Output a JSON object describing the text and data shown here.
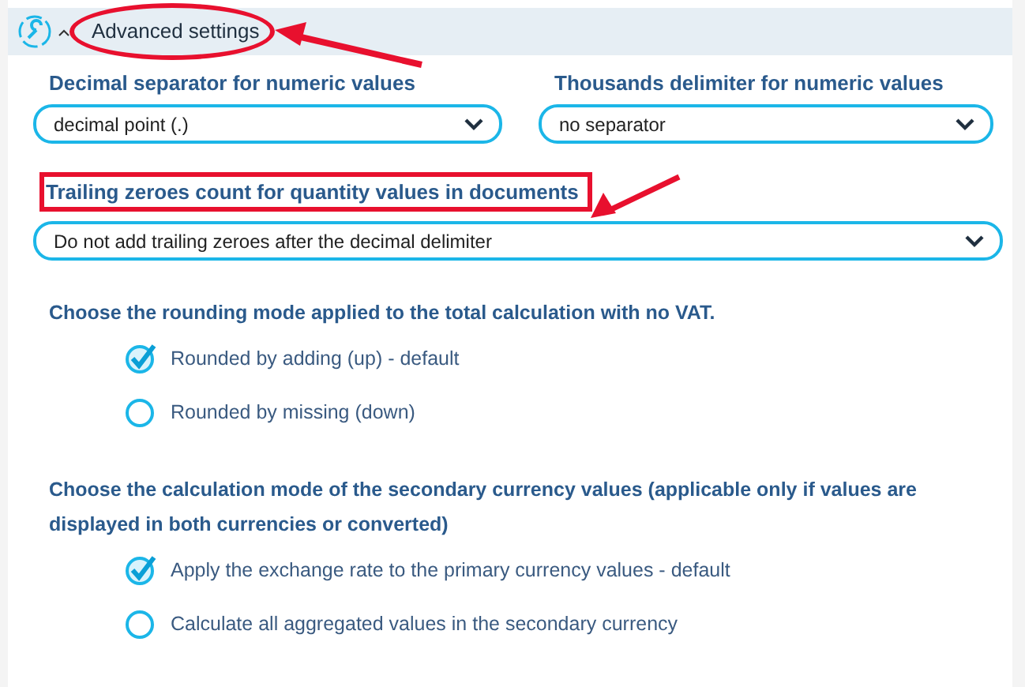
{
  "section": {
    "title": "Advanced settings",
    "expanded": true,
    "highlighted": true
  },
  "selects": [
    {
      "label": "Decimal separator for numeric values",
      "value": "decimal point (.)",
      "highlighted": false
    },
    {
      "label": "Thousands delimiter for numeric values",
      "value": "no separator",
      "highlighted": false
    }
  ],
  "trailing_select": {
    "label": "Trailing zeroes count for quantity values in documents",
    "value": "Do not add trailing zeroes after the decimal delimiter",
    "highlighted": true
  },
  "radio_groups": [
    {
      "question": "Choose the rounding mode applied to the total calculation with no VAT.",
      "options": [
        {
          "label": "Rounded by adding (up) - default",
          "selected": true
        },
        {
          "label": "Rounded by missing (down)",
          "selected": false
        }
      ]
    },
    {
      "question": "Choose the calculation mode of the secondary currency values (applicable only if values are displayed in both currencies or converted)",
      "options": [
        {
          "label": "Apply the exchange rate to the primary currency values - default",
          "selected": true
        },
        {
          "label": "Calculate all aggregated values in the secondary currency",
          "selected": false
        }
      ]
    }
  ]
}
